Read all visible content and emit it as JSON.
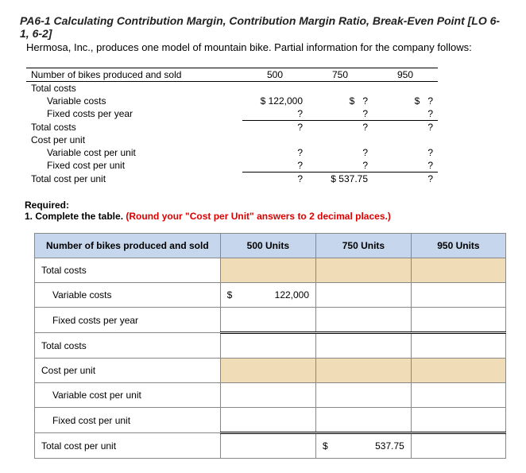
{
  "title": "PA6-1 Calculating Contribution Margin, Contribution Margin Ratio, Break-Even Point [LO 6-1, 6-2]",
  "desc": "Hermosa, Inc., produces one model of mountain bike. Partial information for the company follows:",
  "t1": {
    "r0": {
      "label": "Number of bikes produced and sold",
      "c1": "500",
      "c2": "750",
      "c3": "950"
    },
    "r1": {
      "label": "Total costs"
    },
    "r2": {
      "label": "Variable costs",
      "c1p": "$",
      "c1": "122,000",
      "c2p": "$",
      "c2": "?",
      "c3p": "$",
      "c3": "?"
    },
    "r3": {
      "label": "Fixed costs per year",
      "c1": "?",
      "c2": "?",
      "c3": "?"
    },
    "r4": {
      "label": "Total costs",
      "c1": "?",
      "c2": "?",
      "c3": "?"
    },
    "r5": {
      "label": "Cost per unit"
    },
    "r6": {
      "label": "Variable cost per unit",
      "c1": "?",
      "c2": "?",
      "c3": "?"
    },
    "r7": {
      "label": "Fixed cost per unit",
      "c1": "?",
      "c2": "?",
      "c3": "?"
    },
    "r8": {
      "label": "Total cost per unit",
      "c1": "?",
      "c2p": "$",
      "c2": "537.75",
      "c3": "?"
    }
  },
  "req": {
    "label": "Required:",
    "item": "1.  Complete the table.",
    "note": "(Round your \"Cost per Unit\" answers to 2 decimal places.)"
  },
  "t2": {
    "h0": "Number of bikes produced and sold",
    "h1": "500 Units",
    "h2": "750 Units",
    "h3": "950 Units",
    "r1": "Total costs",
    "r2": "Variable costs",
    "r2c1p": "$",
    "r2c1": "122,000",
    "r3": "Fixed costs per year",
    "r4": "Total costs",
    "r5": "Cost per unit",
    "r6": "Variable cost per unit",
    "r7": "Fixed cost per unit",
    "r8": "Total cost per unit",
    "r8c2p": "$",
    "r8c2": "537.75"
  }
}
